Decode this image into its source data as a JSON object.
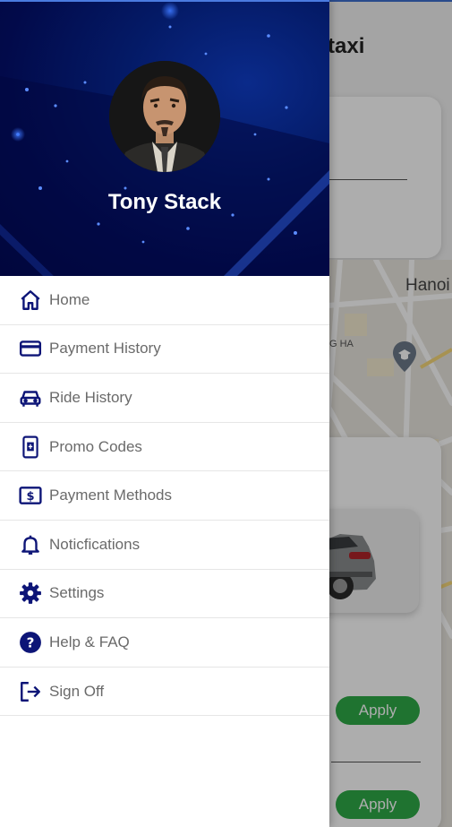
{
  "background_screen": {
    "title_fragment": "taxi",
    "map_city_label": "Hanoi",
    "map_district_label": "G HA",
    "apply_buttons": [
      "Apply",
      "Apply"
    ]
  },
  "drawer": {
    "user_name": "Tony Stack",
    "menu_items": [
      {
        "label": "Home",
        "icon": "home-icon"
      },
      {
        "label": "Payment History",
        "icon": "credit-card-icon"
      },
      {
        "label": "Ride History",
        "icon": "car-icon"
      },
      {
        "label": "Promo Codes",
        "icon": "promo-code-icon"
      },
      {
        "label": "Payment Methods",
        "icon": "dollar-bill-icon"
      },
      {
        "label": "Noticfications",
        "icon": "bell-icon"
      },
      {
        "label": "Settings",
        "icon": "gear-icon"
      },
      {
        "label": "Help & FAQ",
        "icon": "help-icon"
      },
      {
        "label": "Sign Off",
        "icon": "sign-out-icon"
      }
    ]
  },
  "colors": {
    "icon_navy": "#0d1577",
    "header_blue": "#041a66",
    "apply_green": "#2eaa48",
    "label_gray": "#6a6a6a"
  }
}
